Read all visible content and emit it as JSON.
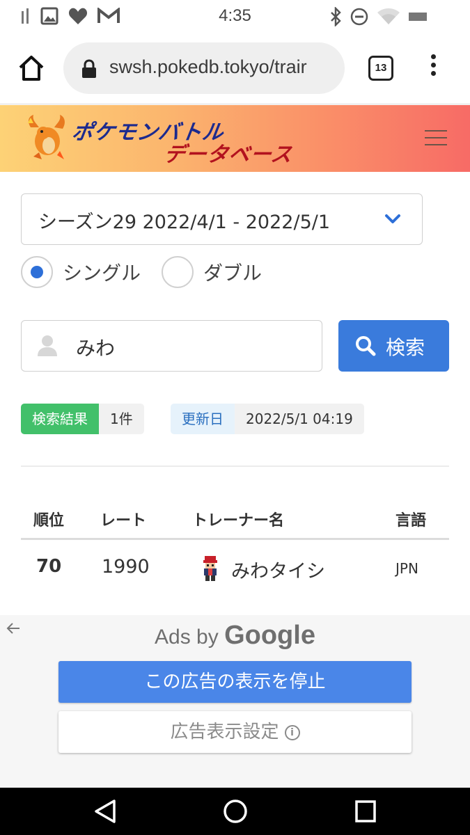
{
  "status_bar": {
    "time": "4:35",
    "left_icons": [
      "signal-icon",
      "image-icon",
      "heart-icon",
      "gmail-icon"
    ],
    "right_icons": [
      "bluetooth-icon",
      "do-not-disturb-icon",
      "wifi-icon",
      "battery-icon"
    ]
  },
  "browser": {
    "url": "swsh.pokedb.tokyo/trair",
    "tab_count": "13"
  },
  "site": {
    "logo_line1": "ポケモンバトル",
    "logo_line2": "データベース"
  },
  "filters": {
    "season_selected": "シーズン29  2022/4/1 - 2022/5/1",
    "radio_single": "シングル",
    "radio_double": "ダブル",
    "selected_mode": "single"
  },
  "search": {
    "value": "みわ",
    "button_label": "検索"
  },
  "badges": {
    "result_tag": "検索結果",
    "result_value": "1件",
    "updated_tag": "更新日",
    "updated_value": "2022/5/1 04:19"
  },
  "table": {
    "headers": {
      "rank": "順位",
      "rate": "レート",
      "trainer": "トレーナー名",
      "language": "言語"
    },
    "rows": [
      {
        "rank": "70",
        "rate": "1990",
        "trainer": "みわタイシ",
        "language": "JPN"
      }
    ]
  },
  "ads": {
    "ads_by": "Ads by",
    "google": "Google",
    "stop_label": "この広告の表示を停止",
    "settings_label": "広告表示設定"
  },
  "colors": {
    "primary_button": "#3a7bdc",
    "result_badge": "#42c06a",
    "header_gradient_start": "#fdd276",
    "header_gradient_end": "#f76b66"
  }
}
